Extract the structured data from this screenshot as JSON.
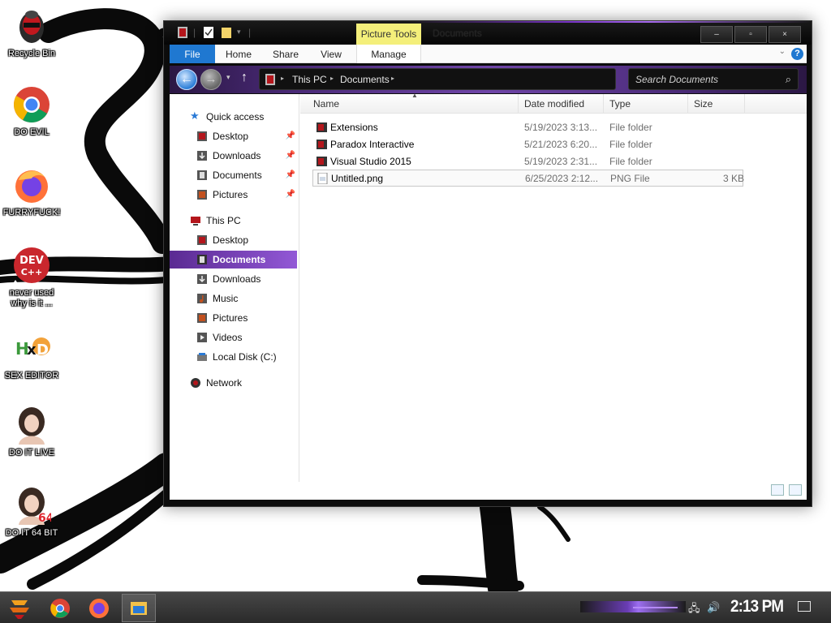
{
  "desktop": {
    "icons": [
      {
        "label": "Recycle Bin"
      },
      {
        "label": "DO EVIL"
      },
      {
        "label": "FURRYFUCK!"
      },
      {
        "label_line1": "never used",
        "label_line2": "why is it ..."
      },
      {
        "label": "SEX EDITOR"
      },
      {
        "label": "DO IT LIVE"
      },
      {
        "label": "DO IT 64 BIT"
      }
    ],
    "dev_logo_top": "DEV",
    "dev_logo_bottom": "C++",
    "hxd_logo": "HxD",
    "bit64_text": "64"
  },
  "window": {
    "title": "Documents",
    "contextual_tab": "Picture Tools",
    "caption_buttons": {
      "minimize": "–",
      "maximize": "▫",
      "close": "×"
    },
    "ribbon_tabs": [
      "File",
      "Home",
      "Share",
      "View",
      "Manage"
    ],
    "help": "?",
    "nav": {
      "back": "←",
      "forward": "→",
      "history": "▾",
      "up": "↑",
      "breadcrumb": [
        "This PC",
        "Documents"
      ],
      "search_placeholder": "Search Documents"
    },
    "sidebar": {
      "quick_access": "Quick access",
      "quick_items": [
        "Desktop",
        "Downloads",
        "Documents",
        "Pictures"
      ],
      "this_pc": "This PC",
      "pc_items": [
        "Desktop",
        "Documents",
        "Downloads",
        "Music",
        "Pictures",
        "Videos",
        "Local Disk (C:)"
      ],
      "network": "Network",
      "selected": "Documents"
    },
    "columns": [
      "Name",
      "Date modified",
      "Type",
      "Size"
    ],
    "files": [
      {
        "name": "Extensions",
        "date": "5/19/2023 3:13...",
        "type": "File folder",
        "size": ""
      },
      {
        "name": "Paradox Interactive",
        "date": "5/21/2023 6:20...",
        "type": "File folder",
        "size": ""
      },
      {
        "name": "Visual Studio 2015",
        "date": "5/19/2023 2:31...",
        "type": "File folder",
        "size": ""
      },
      {
        "name": "Untitled.png",
        "date": "6/25/2023 2:12...",
        "type": "PNG File",
        "size": "3 KB"
      }
    ]
  },
  "taskbar": {
    "clock": "2:13 PM"
  },
  "colors": {
    "accent_purple": "#7a35c8",
    "file_tab_blue": "#1f78d1",
    "picture_tools_yellow": "#f4ef7a"
  }
}
